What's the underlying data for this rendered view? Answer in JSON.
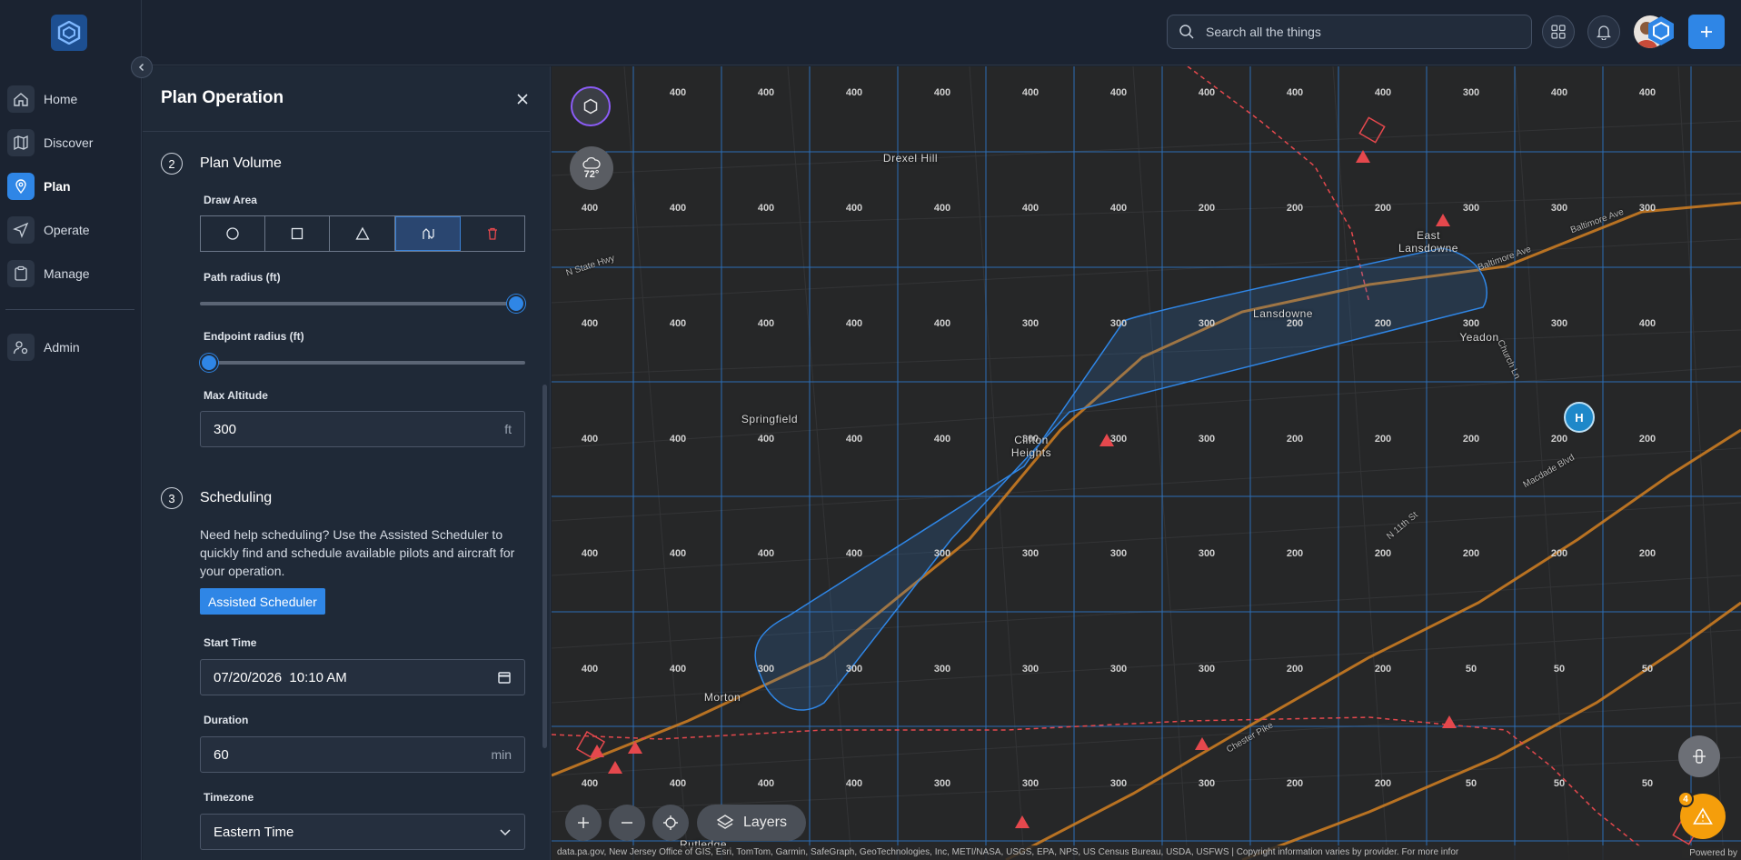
{
  "nav": {
    "items": [
      {
        "label": "Home",
        "icon": "home-icon"
      },
      {
        "label": "Discover",
        "icon": "map-icon"
      },
      {
        "label": "Plan",
        "icon": "location-pin-icon",
        "active": true
      },
      {
        "label": "Operate",
        "icon": "send-icon"
      },
      {
        "label": "Manage",
        "icon": "clipboard-icon"
      },
      {
        "label": "Admin",
        "icon": "admin-icon"
      }
    ]
  },
  "topbar": {
    "search_placeholder": "Search all the things",
    "accent": "#2f86e6"
  },
  "panel": {
    "title": "Plan Operation",
    "step2": {
      "num": "2",
      "title": "Plan Volume",
      "draw_area_label": "Draw Area",
      "draw_tools": [
        "circle-tool-icon",
        "square-tool-icon",
        "triangle-tool-icon",
        "path-tool-icon",
        "trash-icon"
      ],
      "active_tool": "path-tool-icon",
      "path_radius_label": "Path radius (ft)",
      "path_radius_fraction": 1.0,
      "endpoint_radius_label": "Endpoint radius (ft)",
      "endpoint_radius_fraction": 0.0,
      "max_altitude_label": "Max Altitude",
      "max_altitude_value": "300",
      "max_altitude_unit": "ft"
    },
    "step3": {
      "num": "3",
      "title": "Scheduling",
      "help": "Need help scheduling? Use the Assisted Scheduler to quickly find and schedule available pilots and aircraft for your operation.",
      "assisted_button": "Assisted Scheduler",
      "start_time_label": "Start Time",
      "start_time_value": "07/20/2026  10:10 AM",
      "duration_label": "Duration",
      "duration_value": "60",
      "duration_unit": "min",
      "timezone_label": "Timezone",
      "timezone_value": "Eastern Time"
    }
  },
  "map": {
    "weather_temp": "72°",
    "layers_label": "Layers",
    "alert_count": "4",
    "heliport_label": "H",
    "places": [
      {
        "name": "Drexel Hill"
      },
      {
        "name": "East\nLansdowne"
      },
      {
        "name": "Lansdowne"
      },
      {
        "name": "Yeadon"
      },
      {
        "name": "Springfield"
      },
      {
        "name": "Clifton\nHeights"
      },
      {
        "name": "Morton"
      },
      {
        "name": "Rutledge"
      }
    ],
    "roads": [
      "N State Hwy",
      "Baltimore Ave",
      "Baltimore Ave",
      "Church Ln",
      "Macdade Blvd",
      "N 11th St",
      "Chester Pike"
    ],
    "attribution": "data.pa.gov, New Jersey Office of GIS, Esri, TomTom, Garmin, SafeGraph, GeoTechnologies, Inc, METI/NASA, USGS, EPA, NPS, US Census Bureau, USDA, USFWS | Copyright information varies by provider. For more infor",
    "powered_by": "Powered by",
    "grid_rows": [
      [
        "400",
        "400",
        "400",
        "400",
        "400",
        "400",
        "400",
        "400",
        "400",
        "400",
        "300",
        "400",
        "400"
      ],
      [
        "400",
        "400",
        "400",
        "400",
        "400",
        "400",
        "400",
        "200",
        "200",
        "200",
        "300",
        "300",
        "300"
      ],
      [
        "400",
        "400",
        "400",
        "400",
        "400",
        "300",
        "300",
        "300",
        "200",
        "200",
        "300",
        "300",
        "400"
      ],
      [
        "400",
        "400",
        "400",
        "400",
        "400",
        "300",
        "300",
        "300",
        "200",
        "200",
        "200",
        "200",
        "200"
      ],
      [
        "400",
        "400",
        "400",
        "400",
        "300",
        "300",
        "300",
        "300",
        "200",
        "200",
        "200",
        "200",
        "200"
      ],
      [
        "400",
        "400",
        "300",
        "300",
        "300",
        "300",
        "300",
        "300",
        "200",
        "200",
        "50",
        "50",
        "50"
      ],
      [
        "400",
        "400",
        "400",
        "400",
        "300",
        "300",
        "300",
        "300",
        "200",
        "200",
        "50",
        "50",
        "50"
      ]
    ]
  }
}
